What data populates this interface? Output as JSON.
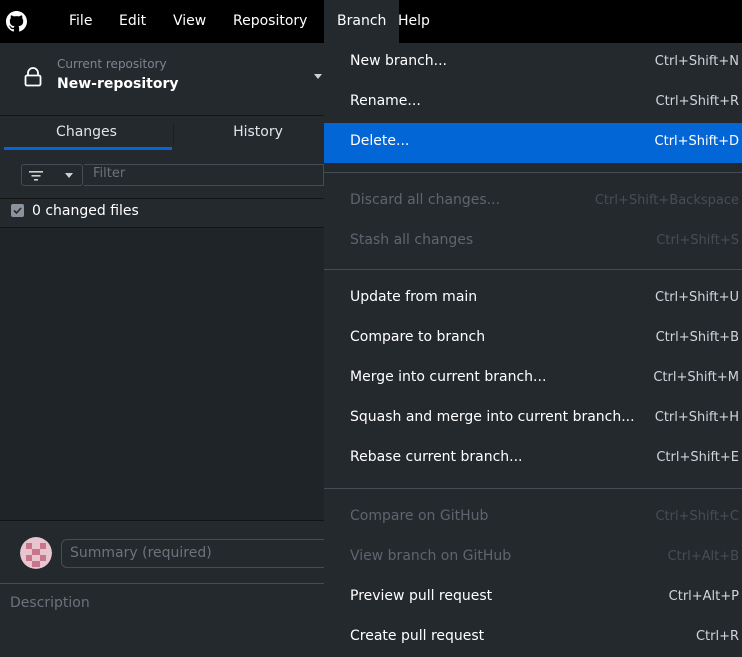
{
  "menubar": {
    "items": [
      {
        "label": "File"
      },
      {
        "label": "Edit"
      },
      {
        "label": "View"
      },
      {
        "label": "Repository"
      },
      {
        "label": "Branch"
      },
      {
        "label": "Help"
      }
    ],
    "active_item": "Branch"
  },
  "repository": {
    "caption": "Current repository",
    "name": "New-repository",
    "icon": "lock-icon"
  },
  "tabs": [
    {
      "label": "Changes",
      "selected": true
    },
    {
      "label": "History",
      "selected": false
    }
  ],
  "filter": {
    "placeholder": "Filter",
    "icon": "filter-lines-icon"
  },
  "changes": {
    "checked": true,
    "label": "0 changed files"
  },
  "commit": {
    "summary_placeholder": "Summary (required)",
    "description_placeholder": "Description"
  },
  "branch_menu": {
    "items": [
      {
        "label": "New branch...",
        "shortcut": "Ctrl+Shift+N",
        "enabled": true
      },
      {
        "label": "Rename...",
        "shortcut": "Ctrl+Shift+R",
        "enabled": true
      },
      {
        "label": "Delete...",
        "shortcut": "Ctrl+Shift+D",
        "enabled": true,
        "highlighted": true
      },
      {
        "label": "Discard all changes...",
        "shortcut": "Ctrl+Shift+Backspace",
        "enabled": false
      },
      {
        "label": "Stash all changes",
        "shortcut": "Ctrl+Shift+S",
        "enabled": false
      },
      {
        "label": "Update from main",
        "shortcut": "Ctrl+Shift+U",
        "enabled": true
      },
      {
        "label": "Compare to branch",
        "shortcut": "Ctrl+Shift+B",
        "enabled": true
      },
      {
        "label": "Merge into current branch...",
        "shortcut": "Ctrl+Shift+M",
        "enabled": true
      },
      {
        "label": "Squash and merge into current branch...",
        "shortcut": "Ctrl+Shift+H",
        "enabled": true
      },
      {
        "label": "Rebase current branch...",
        "shortcut": "Ctrl+Shift+E",
        "enabled": true
      },
      {
        "label": "Compare on GitHub",
        "shortcut": "Ctrl+Shift+C",
        "enabled": false
      },
      {
        "label": "View branch on GitHub",
        "shortcut": "Ctrl+Alt+B",
        "enabled": false
      },
      {
        "label": "Preview pull request",
        "shortcut": "Ctrl+Alt+P",
        "enabled": true
      },
      {
        "label": "Create pull request",
        "shortcut": "Ctrl+R",
        "enabled": true
      }
    ]
  },
  "colors": {
    "menubar_bg": "#000000",
    "panel_bg": "#24292e",
    "highlight": "#0366d6",
    "disabled_text": "#5d656e"
  }
}
